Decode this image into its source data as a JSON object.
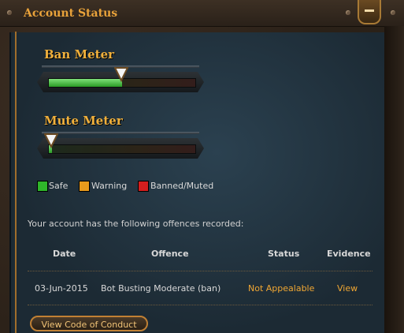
{
  "header": {
    "title": "Account Status"
  },
  "ban_meter": {
    "title": "Ban Meter",
    "level_fraction": 0.5
  },
  "mute_meter": {
    "title": "Mute Meter",
    "level_fraction": 0.02
  },
  "legend": [
    {
      "label": "Safe",
      "color": "#2fb52a"
    },
    {
      "label": "Warning",
      "color": "#e89a1c"
    },
    {
      "label": "Banned/Muted",
      "color": "#d41e1e"
    }
  ],
  "offences": {
    "intro": "Your account has the following offences recorded:",
    "columns": [
      "Date",
      "Offence",
      "Status",
      "Evidence"
    ],
    "rows": [
      {
        "date": "03-Jun-2015",
        "offence": "Bot Busting Moderate (ban)",
        "status": "Not Appealable",
        "evidence": "View"
      }
    ]
  },
  "buttons": {
    "code_of_conduct": "View Code of Conduct"
  }
}
